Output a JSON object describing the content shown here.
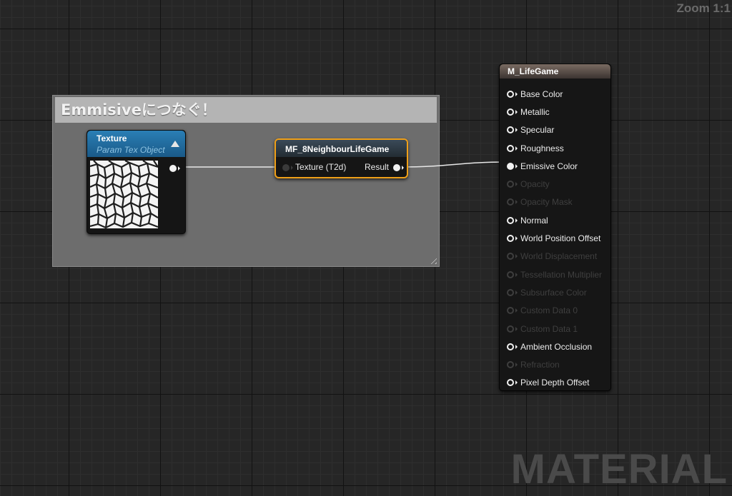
{
  "zoom_label": "Zoom 1:1",
  "watermark": "MATERIAL",
  "comment_box": {
    "title": "Emmisiveにつなぐ！"
  },
  "texture_node": {
    "title": "Texture",
    "subtitle": "Param Tex Object"
  },
  "function_node": {
    "title": "MF_8NeighbourLifeGame",
    "input_label": "Texture (T2d)",
    "output_label": "Result"
  },
  "material_node": {
    "title": "M_LifeGame",
    "pins": [
      {
        "label": "Base Color",
        "enabled": true,
        "connected": false
      },
      {
        "label": "Metallic",
        "enabled": true,
        "connected": false
      },
      {
        "label": "Specular",
        "enabled": true,
        "connected": false
      },
      {
        "label": "Roughness",
        "enabled": true,
        "connected": false
      },
      {
        "label": "Emissive Color",
        "enabled": true,
        "connected": true
      },
      {
        "label": "Opacity",
        "enabled": false,
        "connected": false
      },
      {
        "label": "Opacity Mask",
        "enabled": false,
        "connected": false
      },
      {
        "label": "Normal",
        "enabled": true,
        "connected": false
      },
      {
        "label": "World Position Offset",
        "enabled": true,
        "connected": false
      },
      {
        "label": "World Displacement",
        "enabled": false,
        "connected": false
      },
      {
        "label": "Tessellation Multiplier",
        "enabled": false,
        "connected": false
      },
      {
        "label": "Subsurface Color",
        "enabled": false,
        "connected": false
      },
      {
        "label": "Custom Data 0",
        "enabled": false,
        "connected": false
      },
      {
        "label": "Custom Data 1",
        "enabled": false,
        "connected": false
      },
      {
        "label": "Ambient Occlusion",
        "enabled": true,
        "connected": false
      },
      {
        "label": "Refraction",
        "enabled": false,
        "connected": false
      },
      {
        "label": "Pixel Depth Offset",
        "enabled": true,
        "connected": false
      }
    ]
  },
  "colors": {
    "graph_background": "#262626",
    "function_node_highlight": "#f0a018",
    "texture_header": "#2a7fb5",
    "material_header": "#7a6b62",
    "wire": "#e8e8e8"
  }
}
